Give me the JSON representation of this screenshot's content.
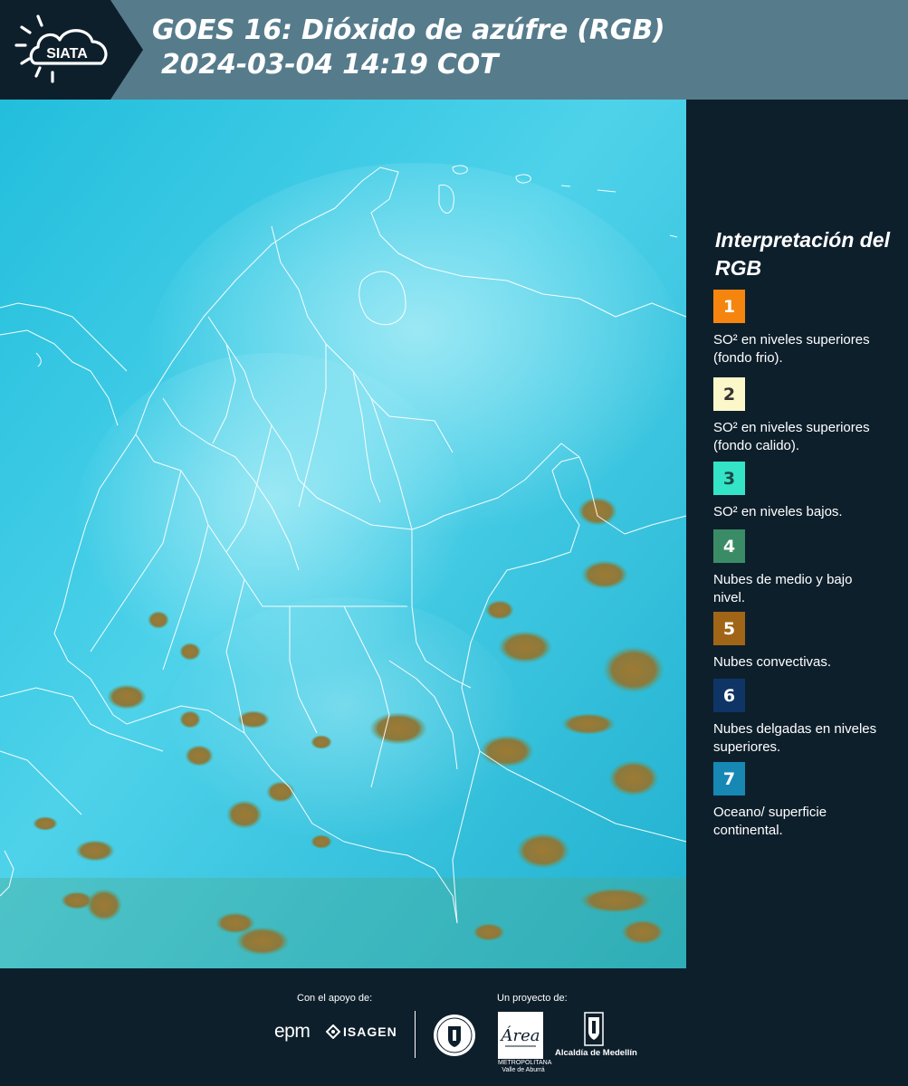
{
  "header": {
    "logo_text": "SIATA",
    "title_line1": "GOES 16: Dióxido de azúfre (RGB)",
    "title_line2": "2024-03-04 14:19 COT"
  },
  "map": {
    "image_type": "satellite-rgb-sulfur-dioxide-composite",
    "colors": {
      "background": "#1ec4e0",
      "clouds": "#9a7a3a",
      "borders": "#ffffff"
    }
  },
  "legend": {
    "title": "Interpretación del RGB",
    "items": [
      {
        "number": "1",
        "color": "#f5850f",
        "number_color": "#ffffff",
        "description": "SO² en niveles superiores (fondo frio)."
      },
      {
        "number": "2",
        "color": "#fbf7c9",
        "number_color": "#333333",
        "description": "SO² en niveles superiores (fondo calido)."
      },
      {
        "number": "3",
        "color": "#34e4c6",
        "number_color": "#1a4a46",
        "description": "SO² en niveles bajos."
      },
      {
        "number": "4",
        "color": "#3a8c66",
        "number_color": "#ffffff",
        "description": "Nubes de medio y bajo nivel."
      },
      {
        "number": "5",
        "color": "#a06517",
        "number_color": "#ffffff",
        "description": "Nubes convectivas."
      },
      {
        "number": "6",
        "color": "#0f3566",
        "number_color": "#ffffff",
        "description": "Nubes delgadas en niveles superiores."
      },
      {
        "number": "7",
        "color": "#1787b4",
        "number_color": "#ffffff",
        "description": "Oceano/ superficie continental."
      }
    ]
  },
  "footer": {
    "support_label": "Con el apoyo de:",
    "project_label": "Un proyecto de:",
    "sponsors": [
      "epm",
      "ISAGEN"
    ],
    "partners": {
      "area_line1": "METROPOLITANA",
      "area_line2": "Valle de Aburrá",
      "area_script": "Área",
      "alcaldia": "Alcaldía de Medellín"
    }
  }
}
